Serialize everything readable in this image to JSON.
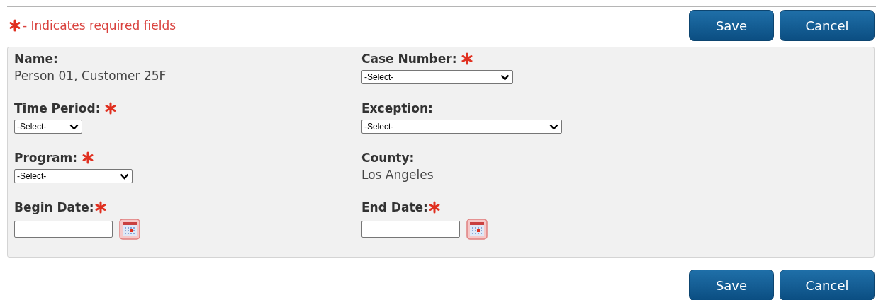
{
  "legend": {
    "text": "- Indicates required fields"
  },
  "top_buttons": [
    "Save",
    "Cancel"
  ],
  "fields": [
    {
      "label": "Name:",
      "required": false,
      "kind": "text",
      "value": "Person 01, Customer 25F"
    },
    {
      "label": "Case Number:",
      "required": true,
      "kind": "select",
      "value": "-Select-"
    },
    {
      "label": "Time Period:",
      "required": true,
      "kind": "select",
      "value": "-Select-"
    },
    {
      "label": "Exception:",
      "required": false,
      "kind": "select",
      "value": "-Select-"
    },
    {
      "label": "Program:",
      "required": true,
      "kind": "select",
      "value": "-Select-"
    },
    {
      "label": "County:",
      "required": false,
      "kind": "text",
      "value": "Los Angeles"
    },
    {
      "label": "Begin Date:",
      "required": true,
      "kind": "date"
    },
    {
      "label": "End Date:",
      "required": true,
      "kind": "date"
    }
  ],
  "bottom_buttons": [
    "Save",
    "Cancel"
  ]
}
